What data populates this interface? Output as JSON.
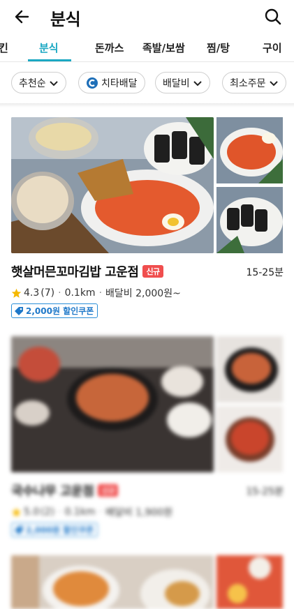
{
  "header": {
    "title": "분식"
  },
  "tabs": [
    {
      "label": "킨"
    },
    {
      "label": "분식"
    },
    {
      "label": "돈까스"
    },
    {
      "label": "족발/보쌈"
    },
    {
      "label": "찜/탕"
    },
    {
      "label": "구이"
    }
  ],
  "filters": [
    {
      "label": "추천순"
    },
    {
      "label": "치타배달"
    },
    {
      "label": "배달비"
    },
    {
      "label": "최소주문"
    }
  ],
  "stores": [
    {
      "name": "햇살머믄꼬마김밥 고운점",
      "badge": "신규",
      "delivery_time": "15-25분",
      "rating": "4.3",
      "reviews": "(7)",
      "distance": "0.1km",
      "delivery_fee": "배달비 2,000원~",
      "coupon": "2,000원 할인쿠폰"
    },
    {
      "name": "국수나무 고운점",
      "badge": "신규",
      "delivery_time": "15-25분",
      "rating": "5.0",
      "reviews": "(2)",
      "distance": "0.1km",
      "delivery_fee": "배달비 1,900원",
      "coupon": "2,000원 할인쿠폰"
    }
  ],
  "colors": {
    "accent": "#1ba8c3",
    "badge": "#f04e4e",
    "coupon": "#1e78c9",
    "star": "#f5b800"
  }
}
